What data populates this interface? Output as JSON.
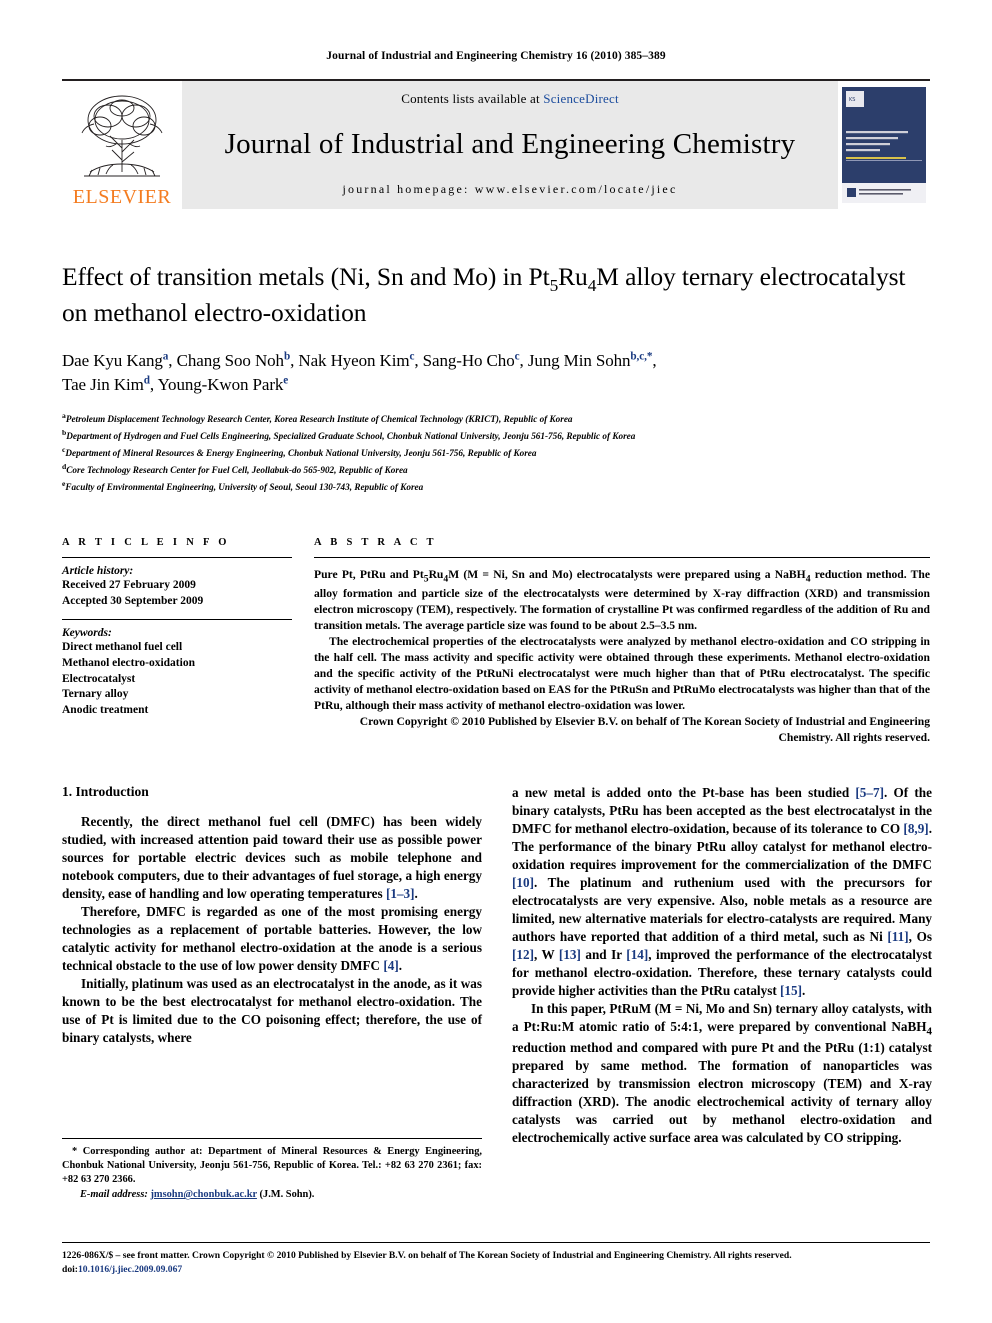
{
  "running_head": "Journal of Industrial and Engineering Chemistry 16 (2010) 385–389",
  "masthead": {
    "contents_prefix": "Contents lists available at ",
    "sciencedirect": "ScienceDirect",
    "journal_name": "Journal of Industrial and Engineering Chemistry",
    "homepage": "journal homepage: www.elsevier.com/locate/jiec",
    "publisher": "ELSEVIER",
    "cover_title_lines": [
      "Journal of",
      "Industrial and",
      "Engineering",
      "Chemistry"
    ],
    "cover_footer": "The Korean Society of Industrial and Engineering Chemistry",
    "link_color": "#1a4b9c",
    "elsevier_orange": "#f47c20",
    "panel_gray": "#e9e9e9"
  },
  "article": {
    "title_line1_a": "Effect of transition metals (Ni, Sn and Mo) in Pt",
    "title_sub1": "5",
    "title_line1_b": "Ru",
    "title_sub2": "4",
    "title_line1_c": "M alloy ternary electrocatalyst",
    "title_line2": "on methanol electro-oxidation",
    "authors": [
      {
        "name": "Dae Kyu Kang",
        "sup": "a",
        "sep": ", "
      },
      {
        "name": "Chang Soo Noh",
        "sup": "b",
        "sep": ", "
      },
      {
        "name": "Nak Hyeon Kim",
        "sup": "c",
        "sep": ", "
      },
      {
        "name": "Sang-Ho Cho",
        "sup": "c",
        "sep": ", "
      },
      {
        "name": "Jung Min Sohn",
        "sup": "b,c,*",
        "sep": ","
      },
      {
        "name": "Tae Jin Kim",
        "sup": "d",
        "sep": ", "
      },
      {
        "name": "Young-Kwon Park",
        "sup": "e",
        "sep": ""
      }
    ],
    "affiliations": [
      {
        "mark": "a",
        "text": "Petroleum Displacement Technology Research Center, Korea Research Institute of Chemical Technology (KRICT), Republic of Korea"
      },
      {
        "mark": "b",
        "text": "Department of Hydrogen and Fuel Cells Engineering, Specialized Graduate School, Chonbuk National University, Jeonju 561-756, Republic of Korea"
      },
      {
        "mark": "c",
        "text": "Department of Mineral Resources & Energy Engineering, Chonbuk National University, Jeonju 561-756, Republic of Korea"
      },
      {
        "mark": "d",
        "text": "Core Technology Research Center for Fuel Cell, Jeollabuk-do 565-902, Republic of Korea"
      },
      {
        "mark": "e",
        "text": "Faculty of Environmental Engineering, University of Seoul, Seoul 130-743, Republic of Korea"
      }
    ]
  },
  "article_info": {
    "label": "A R T I C L E   I N F O",
    "history_head": "Article history:",
    "history_lines": [
      "Received 27 February 2009",
      "Accepted 30 September 2009"
    ],
    "keywords_head": "Keywords:",
    "keywords": [
      "Direct methanol fuel cell",
      "Methanol electro-oxidation",
      "Electrocatalyst",
      "Ternary alloy",
      "Anodic treatment"
    ]
  },
  "abstract": {
    "label": "A B S T R A C T",
    "para1": "Pure Pt, PtRu and Pt5Ru4M (M = Ni, Sn and Mo) electrocatalysts were prepared using a NaBH4 reduction method. The alloy formation and particle size of the electrocatalysts were determined by X-ray diffraction (XRD) and transmission electron microscopy (TEM), respectively. The formation of crystalline Pt was confirmed regardless of the addition of Ru and transition metals. The average particle size was found to be about 2.5–3.5 nm.",
    "para2": "The electrochemical properties of the electrocatalysts were analyzed by methanol electro-oxidation and CO stripping in the half cell. The mass activity and specific activity were obtained through these experiments. Methanol electro-oxidation and the specific activity of the PtRuNi electrocatalyst were much higher than that of PtRu electrocatalyst. The specific activity of methanol electro-oxidation based on EAS for the PtRuSn and PtRuMo electrocatalysts was higher than that of the PtRu, although their mass activity of methanol electro-oxidation was lower.",
    "copyright": "Crown Copyright © 2010 Published by Elsevier B.V. on behalf of The Korean Society of Industrial and Engineering Chemistry. All rights reserved."
  },
  "introduction": {
    "heading": "1. Introduction",
    "left_paras": [
      "Recently, the direct methanol fuel cell (DMFC) has been widely studied, with increased attention paid toward their use as possible power sources for portable electric devices such as mobile telephone and notebook computers, due to their advantages of fuel storage, a high energy density, ease of handling and low operating temperatures [1–3].",
      "Therefore, DMFC is regarded as one of the most promising energy technologies as a replacement of portable batteries. However, the low catalytic activity for methanol electro-oxidation at the anode is a serious technical obstacle to the use of low power density DMFC [4].",
      "Initially, platinum was used as an electrocatalyst in the anode, as it was known to be the best electrocatalyst for methanol electro-oxidation. The use of Pt is limited due to the CO poisoning effect; therefore, the use of binary catalysts, where"
    ],
    "right_paras": [
      "a new metal is added onto the Pt-base has been studied [5–7]. Of the binary catalysts, PtRu has been accepted as the best electrocatalyst in the DMFC for methanol electro-oxidation, because of its tolerance to CO [8,9]. The performance of the binary PtRu alloy catalyst for methanol electro-oxidation requires improvement for the commercialization of the DMFC [10]. The platinum and ruthenium used with the precursors for electrocatalysts are very expensive. Also, noble metals as a resource are limited, new alternative materials for electro-catalysts are required. Many authors have reported that addition of a third metal, such as Ni [11], Os [12], W [13] and Ir [14], improved the performance of the electrocatalyst for methanol electro-oxidation. Therefore, these ternary catalysts could provide higher activities than the PtRu catalyst [15].",
      "In this paper, PtRuM (M = Ni, Mo and Sn) ternary alloy catalysts, with a Pt:Ru:M atomic ratio of 5:4:1, were prepared by conventional NaBH4 reduction method and compared with pure Pt and the PtRu (1:1) catalyst prepared by same method. The formation of nanoparticles was characterized by transmission electron microscopy (TEM) and X-ray diffraction (XRD). The anodic electrochemical activity of ternary alloy catalysts was carried out by methanol electro-oxidation and electrochemically active surface area was calculated by CO stripping."
    ],
    "citation_color": "#1a3a80"
  },
  "footnote": {
    "corresponding": "* Corresponding author at: Department of Mineral Resources & Energy Engineering, Chonbuk National University, Jeonju 561-756, Republic of Korea. Tel.: +82 63 270 2361; fax: +82 63 270 2366.",
    "email_label": "E-mail address:",
    "email": "jmsohn@chonbuk.ac.kr",
    "email_owner": "(J.M. Sohn)."
  },
  "page_footer": {
    "line1": "1226-086X/$ – see front matter. Crown Copyright © 2010 Published by Elsevier B.V. on behalf of The Korean Society of Industrial and Engineering Chemistry. All rights reserved.",
    "doi_label": "doi:",
    "doi": "10.1016/j.jiec.2009.09.067"
  }
}
